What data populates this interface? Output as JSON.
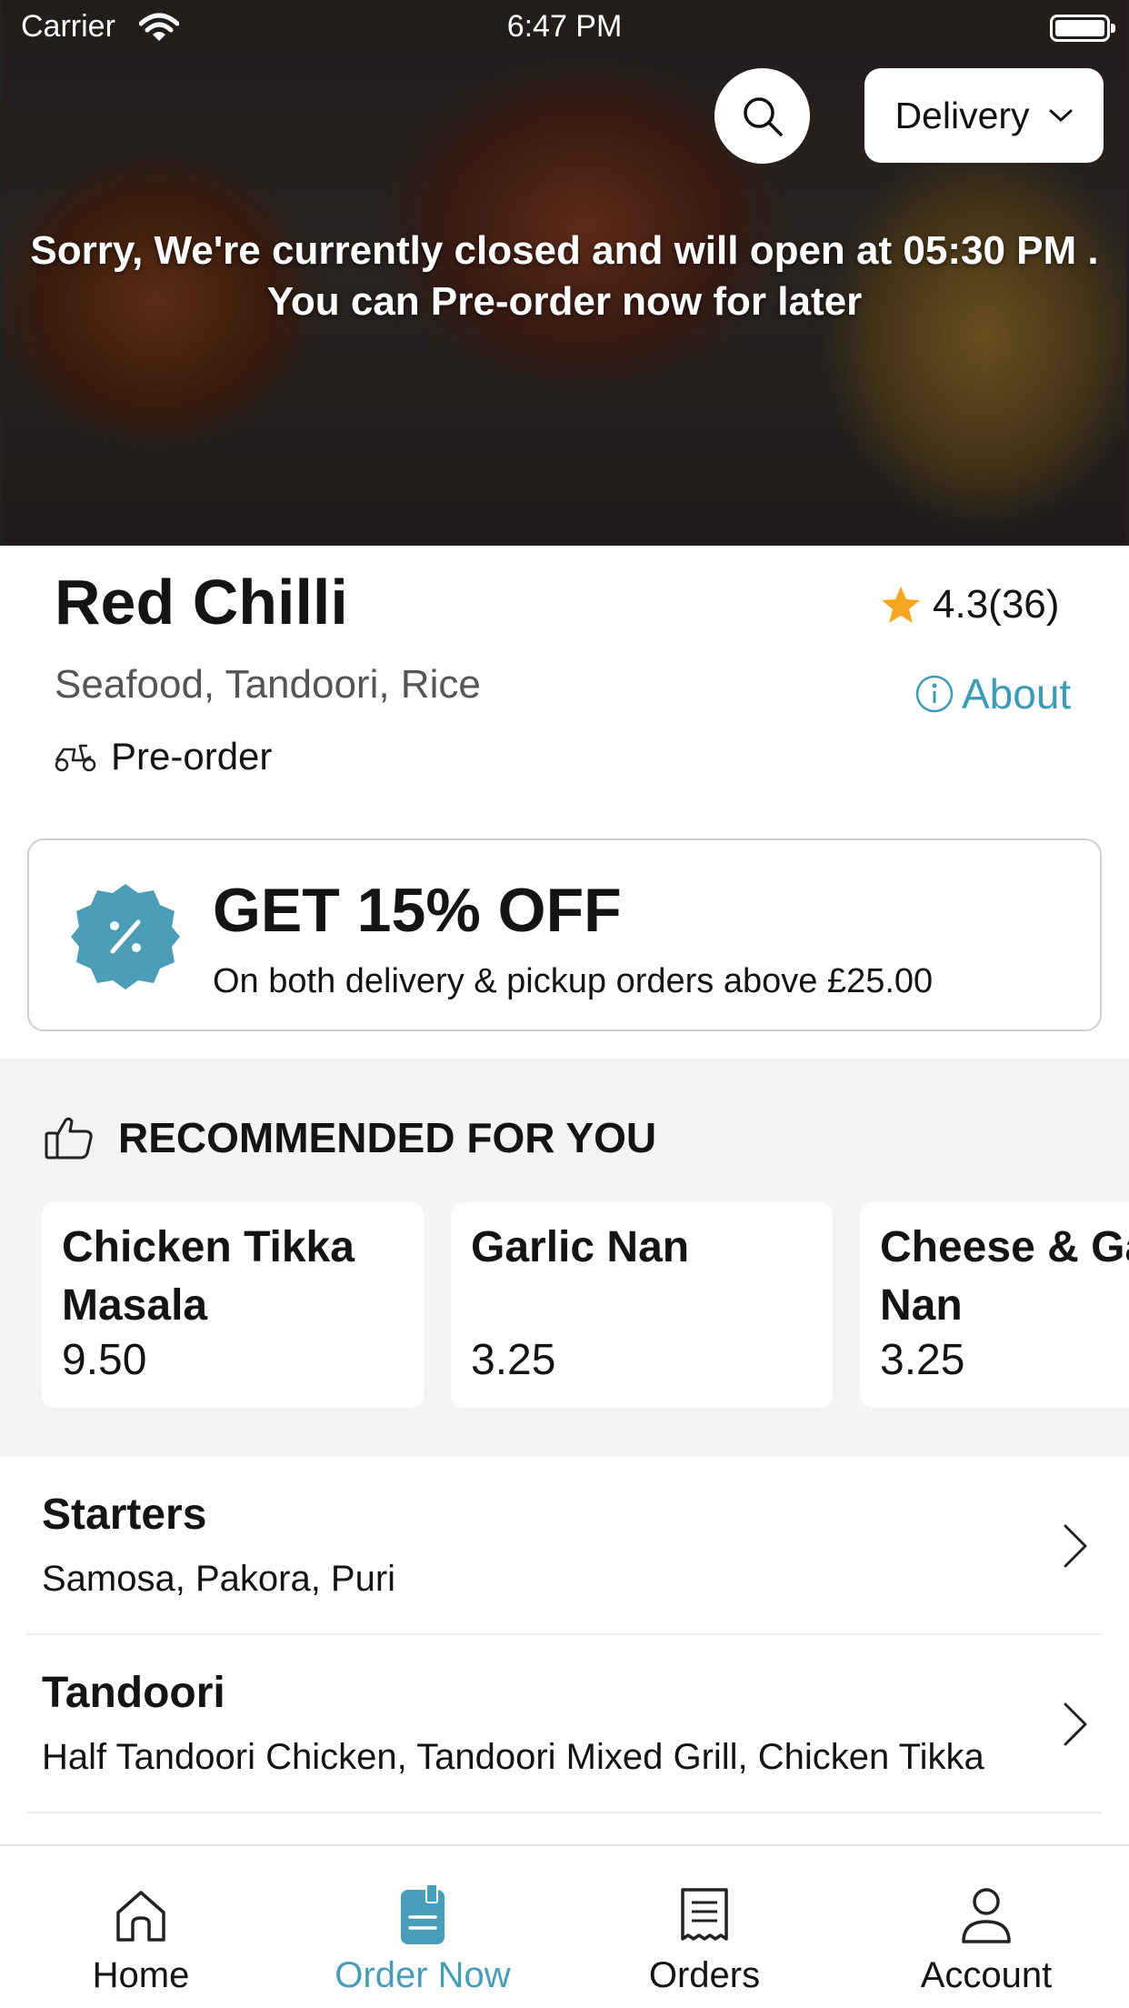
{
  "status_bar": {
    "carrier": "Carrier",
    "time": "6:47 PM"
  },
  "hero": {
    "delivery_label": "Delivery",
    "closed_line1": "Sorry, We're currently closed and will open at 05:30 PM .",
    "closed_line2": "You can Pre-order now for later"
  },
  "restaurant": {
    "name": "Red Chilli",
    "rating": "4.3(36)",
    "cuisines": "Seafood, Tandoori, Rice",
    "about_label": "About",
    "order_mode": "Pre-order"
  },
  "offer": {
    "title": "GET 15% OFF",
    "subtitle": "On both delivery & pickup orders above £25.00"
  },
  "recommended": {
    "heading": "RECOMMENDED FOR YOU",
    "items": [
      {
        "name": "Chicken Tikka Masala",
        "price": "9.50"
      },
      {
        "name": "Garlic Nan",
        "price": "3.25"
      },
      {
        "name": "Cheese & Garlic Nan",
        "price": "3.25"
      }
    ]
  },
  "categories": [
    {
      "title": "Starters",
      "items": "Samosa, Pakora, Puri"
    },
    {
      "title": "Tandoori",
      "items": "Half Tandoori Chicken, Tandoori Mixed Grill, Chicken Tikka"
    }
  ],
  "tabs": [
    {
      "label": "Home",
      "icon": "home-icon"
    },
    {
      "label": "Order Now",
      "icon": "order-now-icon"
    },
    {
      "label": "Orders",
      "icon": "receipt-icon"
    },
    {
      "label": "Account",
      "icon": "account-icon"
    }
  ],
  "colors": {
    "accent": "#4a9db8",
    "star": "#f5a623",
    "badge": "#4c9db7"
  }
}
